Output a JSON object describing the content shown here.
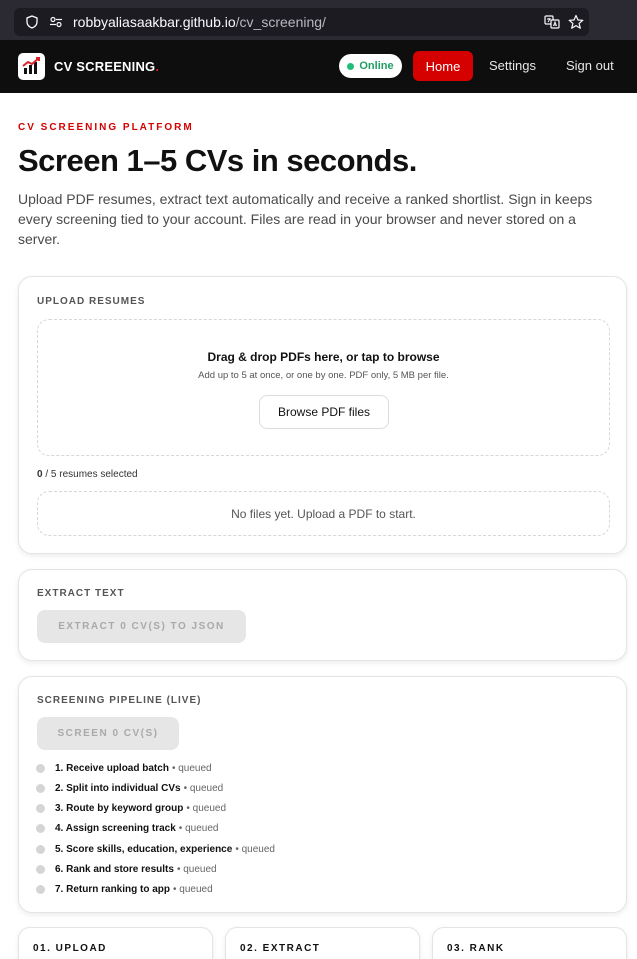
{
  "browser": {
    "url_host": "robbyaliasaakbar.github.io",
    "url_path": "/cv_screening/"
  },
  "header": {
    "brand": "CV SCREENING",
    "brand_dot": ".",
    "status": "Online",
    "nav": {
      "home": "Home",
      "settings": "Settings",
      "signout": "Sign out"
    }
  },
  "hero": {
    "kicker": "CV SCREENING PLATFORM",
    "title": "Screen 1–5 CVs in seconds.",
    "lead": "Upload PDF resumes, extract text automatically and receive a ranked shortlist. Sign in keeps every screening tied to your account. Files are read in your browser and never stored on a server."
  },
  "upload": {
    "title": "UPLOAD RESUMES",
    "drop_title": "Drag & drop PDFs here, or tap to browse",
    "drop_sub": "Add up to 5 at once, or one by one. PDF only, 5 MB per file.",
    "browse_label": "Browse PDF files",
    "count_selected": "0",
    "count_rest": " / 5 resumes selected",
    "empty_msg": "No files yet. Upload a PDF to start."
  },
  "extract": {
    "title": "EXTRACT TEXT",
    "button": "EXTRACT 0 CV(S) TO JSON"
  },
  "pipeline": {
    "title": "SCREENING PIPELINE (LIVE)",
    "button": "SCREEN 0 CV(S)",
    "steps": [
      {
        "label": "1. Receive upload batch",
        "status": "• queued"
      },
      {
        "label": "2. Split into individual CVs",
        "status": "• queued"
      },
      {
        "label": "3. Route by keyword group",
        "status": "• queued"
      },
      {
        "label": "4. Assign screening track",
        "status": "• queued"
      },
      {
        "label": "5. Score skills, education, experience",
        "status": "• queued"
      },
      {
        "label": "6. Rank and store results",
        "status": "• queued"
      },
      {
        "label": "7. Return ranking to app",
        "status": "• queued"
      }
    ]
  },
  "stages": [
    "01. UPLOAD",
    "02. EXTRACT",
    "03. RANK"
  ],
  "colors": {
    "accent": "#d50000",
    "online": "#1f9e63",
    "header_bg": "#0e0e0e"
  }
}
